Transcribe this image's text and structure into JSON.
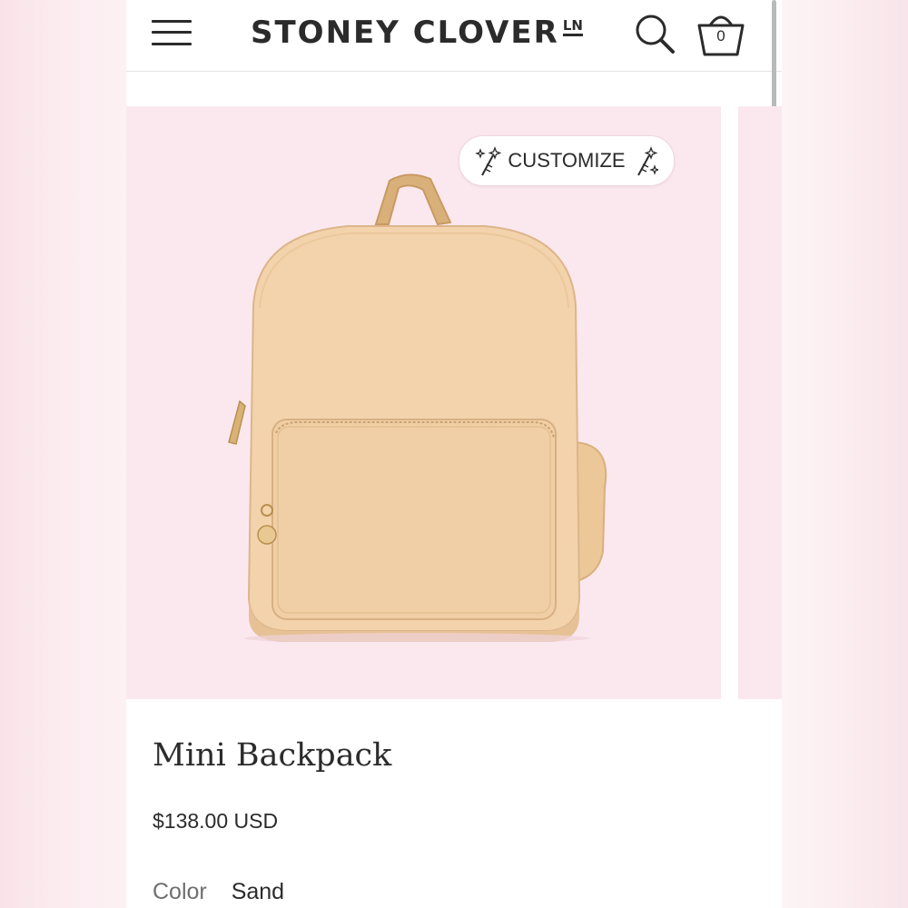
{
  "header": {
    "menu_icon": "hamburger-menu-icon",
    "logo_text": "STONEY CLOVER",
    "logo_mark": "LN",
    "search_icon": "search-icon",
    "cart_icon": "shopping-basket-icon",
    "cart_count": "0"
  },
  "gallery": {
    "customize_label": "CUSTOMIZE",
    "customize_icons": [
      "magic-wand-icon",
      "magic-wand-icon"
    ],
    "background_color": "#fbe8ef",
    "product_color": "#f3d3ac"
  },
  "product": {
    "title": "Mini Backpack",
    "price": "$138.00 USD",
    "color_label": "Color",
    "color_value": "Sand"
  }
}
